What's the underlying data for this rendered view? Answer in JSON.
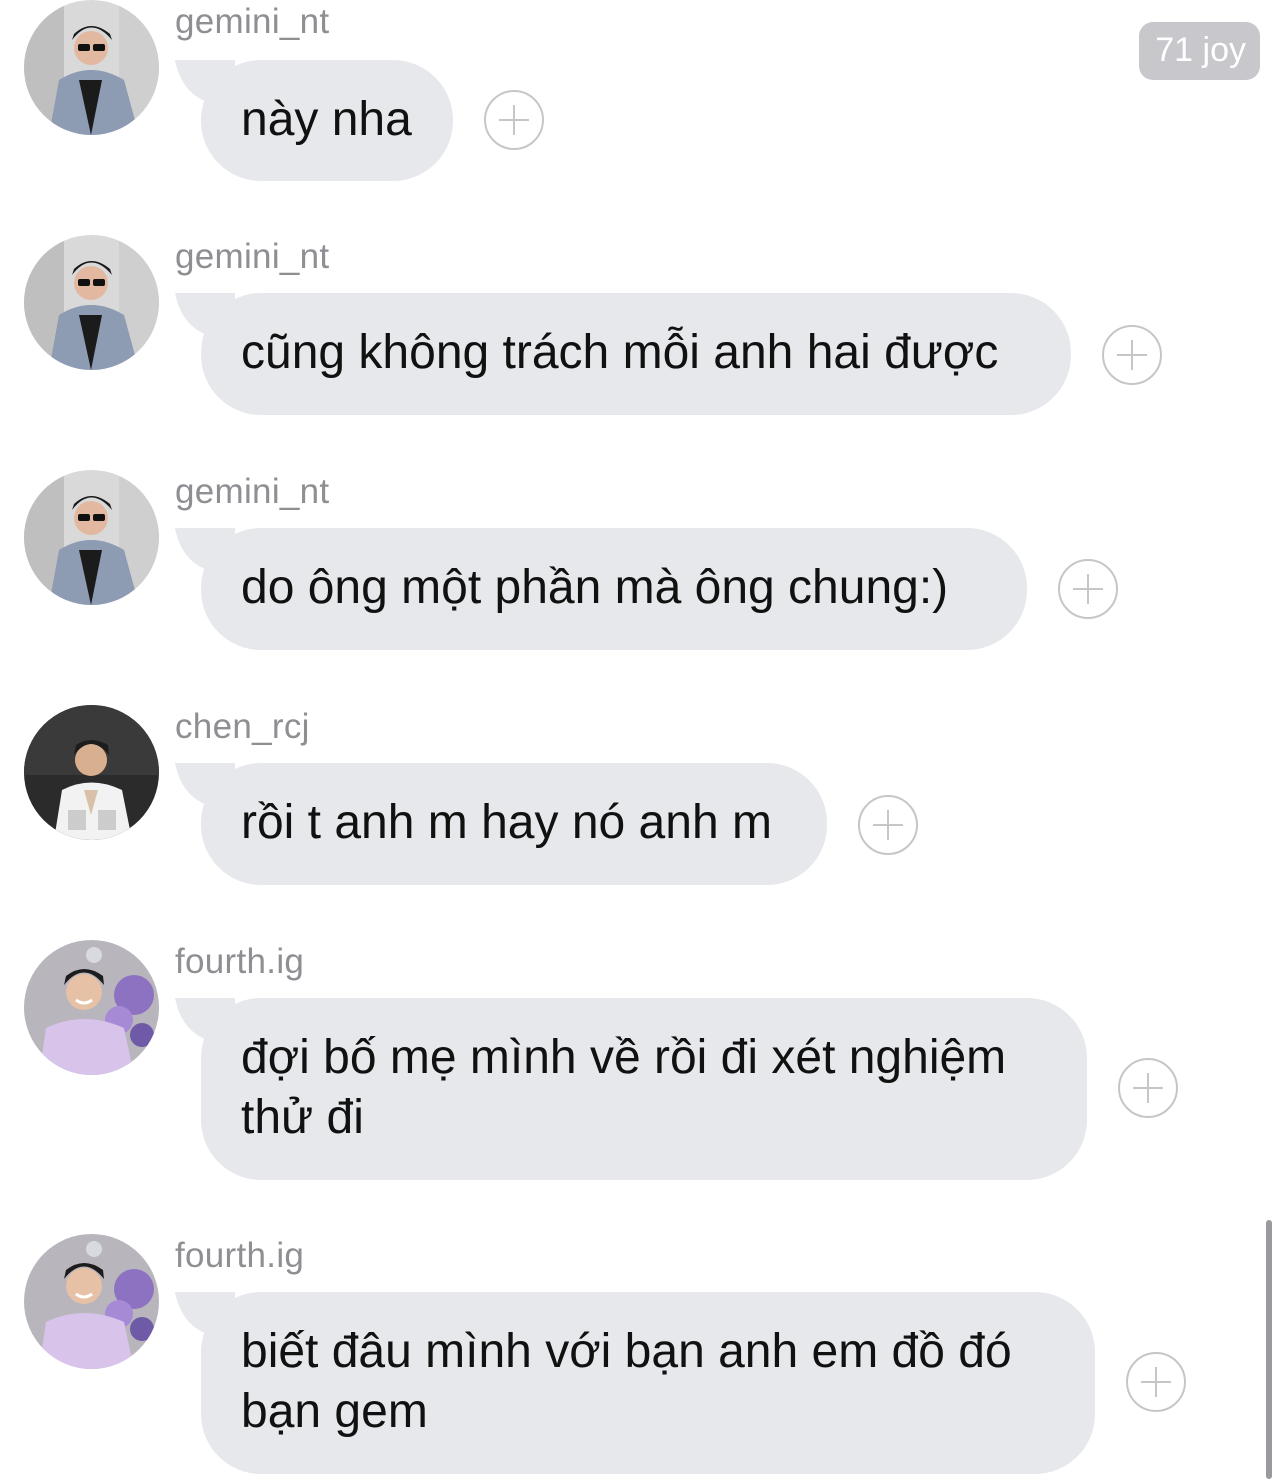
{
  "badge": {
    "text": "71 joy"
  },
  "messages": [
    {
      "sender": "gemini_nt",
      "avatar": "avatar-gemini",
      "text": "này nha"
    },
    {
      "sender": "gemini_nt",
      "avatar": "avatar-gemini",
      "text": "cũng không trách mỗi anh hai được"
    },
    {
      "sender": "gemini_nt",
      "avatar": "avatar-gemini",
      "text": "do ông một phần mà ông chung:)"
    },
    {
      "sender": "chen_rcj",
      "avatar": "avatar-chen",
      "text": "rồi t anh m hay nó anh m"
    },
    {
      "sender": "fourth.ig",
      "avatar": "avatar-fourth",
      "text": "đợi bố mẹ mình về rồi đi xét nghiệm thử đi"
    },
    {
      "sender": "fourth.ig",
      "avatar": "avatar-fourth",
      "text": "biết đâu mình với bạn anh em đồ đó bạn gem"
    }
  ],
  "colors": {
    "bubble": "#e6e8eb",
    "sender_text": "#8e8e93",
    "add_button": "#c6c6c8",
    "badge_bg": "#c7c7cc"
  },
  "icons": {
    "add_reaction": "plus-circle-icon"
  }
}
